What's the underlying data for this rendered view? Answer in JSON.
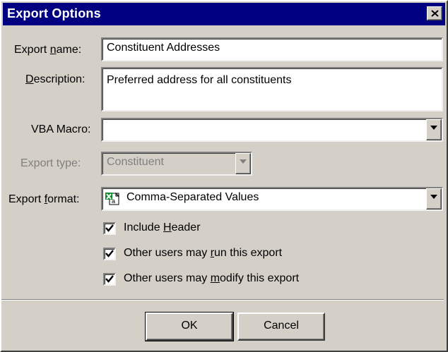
{
  "window": {
    "title": "Export Options"
  },
  "fields": {
    "export_name": {
      "label_pre": "Export ",
      "label_u": "n",
      "label_post": "ame:",
      "value": "Constituent Addresses"
    },
    "description": {
      "label_pre": "",
      "label_u": "D",
      "label_post": "escription:",
      "value": "Preferred address for all constituents"
    },
    "vba_macro": {
      "label": "VBA Macro:",
      "value": ""
    },
    "export_type": {
      "label": "Export type:",
      "value": "Constituent"
    },
    "export_format": {
      "label_pre": "Export ",
      "label_u": "f",
      "label_post": "ormat:",
      "value": "Comma-Separated Values"
    }
  },
  "options": {
    "include_header": {
      "pre": "Include ",
      "u": "H",
      "post": "eader",
      "checked": true
    },
    "others_run": {
      "pre": "Other users may ",
      "u": "r",
      "post": "un this export",
      "checked": true
    },
    "others_modify": {
      "pre": "Other users may ",
      "u": "m",
      "post": "odify this export",
      "checked": true
    }
  },
  "buttons": {
    "ok": "OK",
    "cancel": "Cancel"
  },
  "icons": {
    "close": "close-icon",
    "dropdown": "chevron-down-icon",
    "format": "excel-csv-icon",
    "check": "checkmark-icon"
  }
}
